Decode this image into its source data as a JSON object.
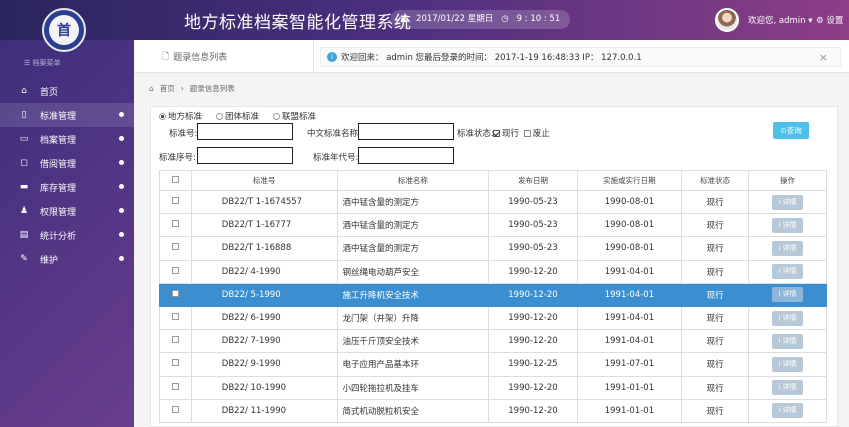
{
  "app_title": "地方标准档案智能化管理系统",
  "logo_text": "首",
  "clock": {
    "date": "2017/01/22 星期日",
    "time": "9 : 10 : 51"
  },
  "user": {
    "greeting": "欢迎您, admin ▾",
    "settings": "设置"
  },
  "sidebar": {
    "header": "档案菜单",
    "items": [
      {
        "label": "首页",
        "icon": "home-icon",
        "glyph": "⌂",
        "dot": false
      },
      {
        "label": "标准管理",
        "icon": "file-icon",
        "glyph": "▯",
        "dot": true
      },
      {
        "label": "档案管理",
        "icon": "folder-icon",
        "glyph": "▭",
        "dot": true
      },
      {
        "label": "借阅管理",
        "icon": "comment-icon",
        "glyph": "◻",
        "dot": true
      },
      {
        "label": "库存管理",
        "icon": "card-icon",
        "glyph": "▬",
        "dot": true
      },
      {
        "label": "权限管理",
        "icon": "users-icon",
        "glyph": "♟",
        "dot": true
      },
      {
        "label": "统计分析",
        "icon": "chart-icon",
        "glyph": "▤",
        "dot": true
      },
      {
        "label": "维护",
        "icon": "wrench-icon",
        "glyph": "✎",
        "dot": true
      }
    ]
  },
  "tab": {
    "label": "题录信息列表"
  },
  "welcome": {
    "text": "欢迎回来： admin  您最后登录的时间： 2017-1-19 16:48:33   IP： 127.0.0.1",
    "close": "×"
  },
  "breadcrumb": {
    "home": "首页",
    "sep": "›",
    "current": "题录信息列表"
  },
  "filters": {
    "radios": [
      {
        "label": "地方标准",
        "checked": true
      },
      {
        "label": "团体标准",
        "checked": false
      },
      {
        "label": "联盟标准",
        "checked": false
      }
    ],
    "std_no_label": "标准号:",
    "cn_name_label": "中文标准名称:",
    "status_label": "标准状态:",
    "status_current": "现行",
    "status_void": "废止",
    "seq_label": "标准序号:",
    "year_label": "标准年代号:",
    "query_button": "⊙查询"
  },
  "table": {
    "headers": [
      "标准号",
      "标准名称",
      "发布日期",
      "实施或实行日期",
      "标准状态",
      "操作"
    ],
    "detail_label": "i 详情",
    "selected_index": 4,
    "rows": [
      [
        "DB22/T 1-1674557",
        "酒中锰含量的测定方",
        "1990-05-23",
        "1990-08-01",
        "现行"
      ],
      [
        "DB22/T 1-16777",
        "酒中锰含量的测定方",
        "1990-05-23",
        "1990-08-01",
        "现行"
      ],
      [
        "DB22/T 1-16888",
        "酒中锰含量的测定方",
        "1990-05-23",
        "1990-08-01",
        "现行"
      ],
      [
        "DB22/ 4-1990",
        "钢丝绳电动葫芦安全",
        "1990-12-20",
        "1991-04-01",
        "现行"
      ],
      [
        "DB22/ 5-1990",
        "施工升降机安全技术",
        "1990-12-20",
        "1991-04-01",
        "现行"
      ],
      [
        "DB22/ 6-1990",
        "龙门架（井架）升降",
        "1990-12-20",
        "1991-04-01",
        "现行"
      ],
      [
        "DB22/ 7-1990",
        "油压千斤顶安全技术",
        "1990-12-20",
        "1991-04-01",
        "现行"
      ],
      [
        "DB22/ 9-1990",
        "电子应用产品基本环",
        "1990-12-25",
        "1991-07-01",
        "现行"
      ],
      [
        "DB22/ 10-1990",
        "小四轮拖拉机及挂车",
        "1990-12-20",
        "1991-01-01",
        "现行"
      ],
      [
        "DB22/ 11-1990",
        "简式机动脱粒机安全",
        "1990-12-20",
        "1991-01-01",
        "现行"
      ]
    ]
  }
}
